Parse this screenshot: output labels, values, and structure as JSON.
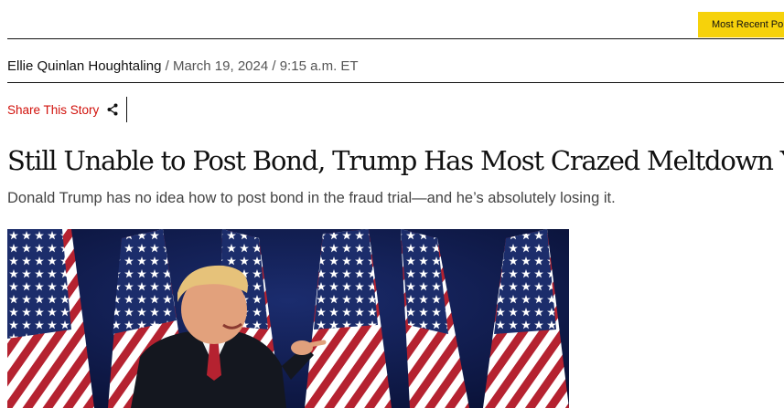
{
  "header": {
    "most_recent_label": "Most Recent Po"
  },
  "byline": {
    "author": "Ellie Quinlan Houghtaling",
    "separator": "/",
    "date": "March 19, 2024",
    "time": "9:15 a.m. ET"
  },
  "share": {
    "label": "Share This Story",
    "icon": "share-icon"
  },
  "article": {
    "headline": "Still Unable to Post Bond, Trump Has Most Crazed Meltdown Yet",
    "dek": "Donald Trump has no idea how to post bond in the fraud trial—and he’s absolutely losing it."
  },
  "colors": {
    "accent_yellow": "#f6d20b",
    "share_red": "#d1110b",
    "flag_navy": "#1c2d6b",
    "flag_red": "#b52230"
  }
}
